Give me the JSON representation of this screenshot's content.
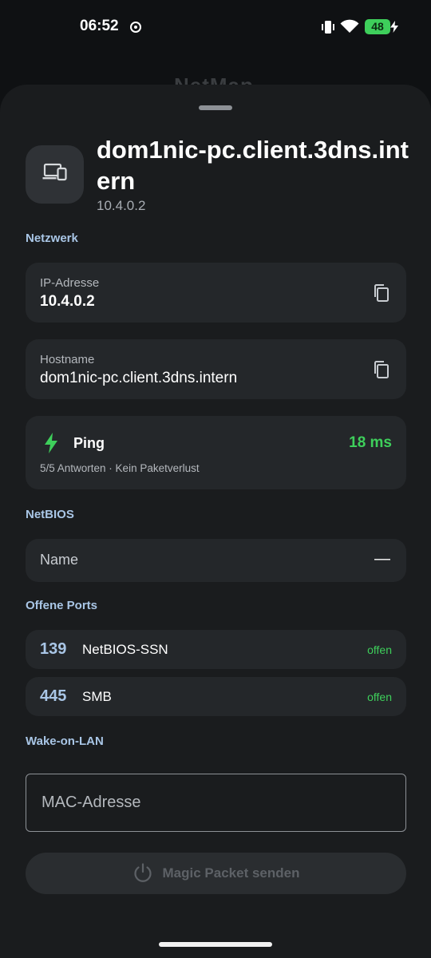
{
  "status_bar": {
    "time": "06:52",
    "battery": "48"
  },
  "behind_title": "NetMap",
  "device": {
    "icon": "devices-icon",
    "title": "dom1nic-pc.client.3dns.intern",
    "ip": "10.4.0.2"
  },
  "network": {
    "section_label": "Netzwerk",
    "ip_card": {
      "label": "IP-Adresse",
      "value": "10.4.0.2"
    },
    "hostname_card": {
      "label": "Hostname",
      "value": "dom1nic-pc.client.3dns.intern"
    }
  },
  "ping": {
    "label": "Ping",
    "value": "18 ms",
    "summary": "5/5 Antworten · Kein Paketverlust"
  },
  "netbios": {
    "section_label": "NetBIOS",
    "name_label": "Name",
    "name_value": "—"
  },
  "ports": {
    "section_label": "Offene Ports",
    "items": [
      {
        "port": "139",
        "name": "NetBIOS-SSN",
        "status": "offen"
      },
      {
        "port": "445",
        "name": "SMB",
        "status": "offen"
      }
    ]
  },
  "wol": {
    "section_label": "Wake-on-LAN",
    "mac_placeholder": "MAC-Adresse",
    "mac_value": "",
    "button_label": "Magic Packet senden"
  },
  "colors": {
    "accent_blue": "#a9c6e6",
    "success_green": "#3ecf5b",
    "sheet_bg": "#1a1c1e",
    "card_bg": "#24272a"
  }
}
